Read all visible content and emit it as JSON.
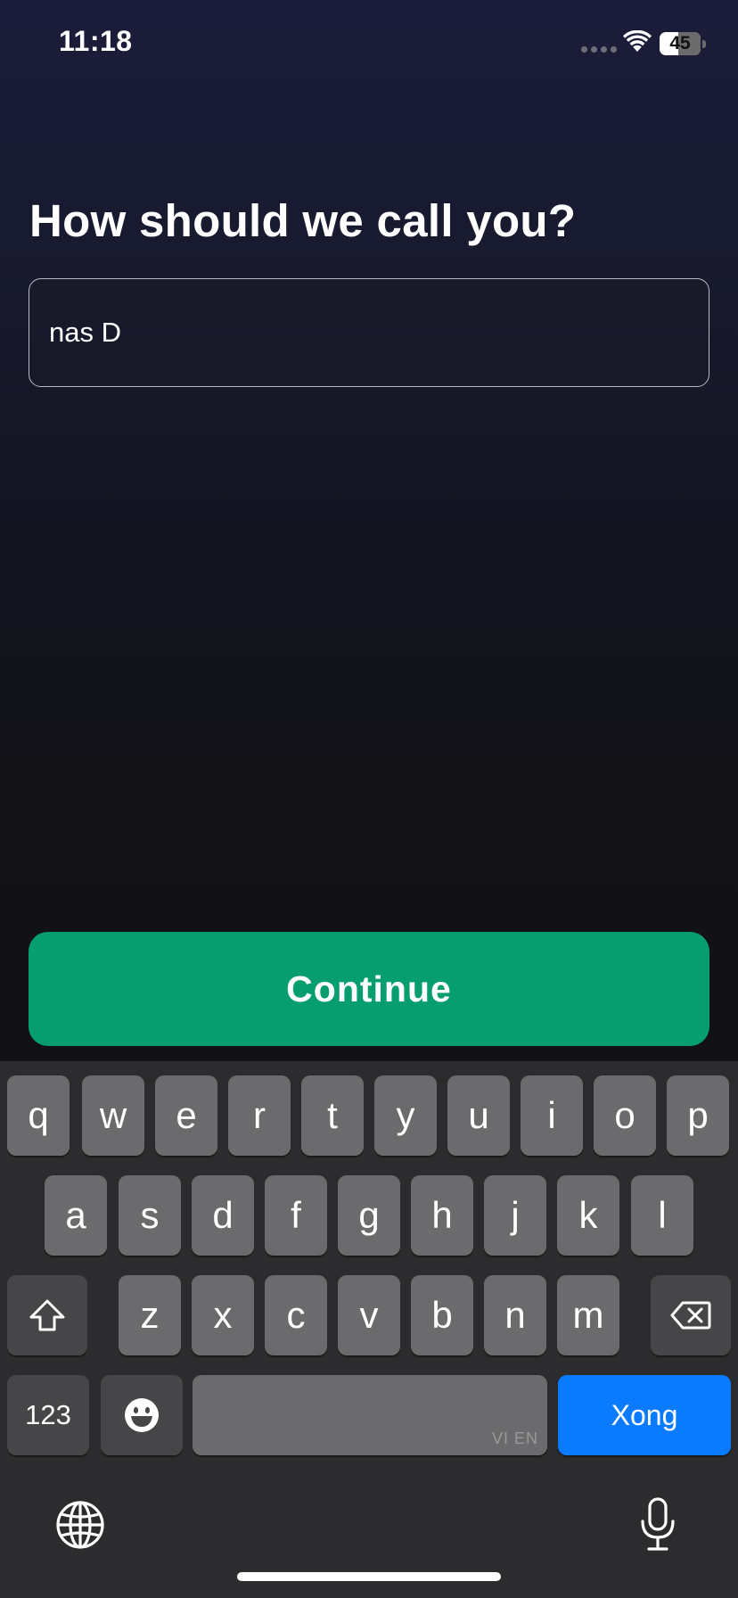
{
  "status_bar": {
    "time": "11:18",
    "battery_percent": "45",
    "battery_level": 0.45
  },
  "page": {
    "title": "How should we call you?",
    "name_value": "nas D",
    "continue_label": "Continue"
  },
  "keyboard": {
    "row1": [
      "q",
      "w",
      "e",
      "r",
      "t",
      "y",
      "u",
      "i",
      "o",
      "p"
    ],
    "row2": [
      "a",
      "s",
      "d",
      "f",
      "g",
      "h",
      "j",
      "k",
      "l"
    ],
    "row3": [
      "z",
      "x",
      "c",
      "v",
      "b",
      "n",
      "m"
    ],
    "numbers_label": "123",
    "space_hint": "VI EN",
    "return_label": "Xong",
    "icons": {
      "shift": "shift-icon",
      "delete": "backspace-icon",
      "emoji": "emoji-icon",
      "globe": "globe-icon",
      "mic": "microphone-icon"
    }
  },
  "colors": {
    "accent": "#069e6e",
    "return_key": "#0a7bff"
  }
}
